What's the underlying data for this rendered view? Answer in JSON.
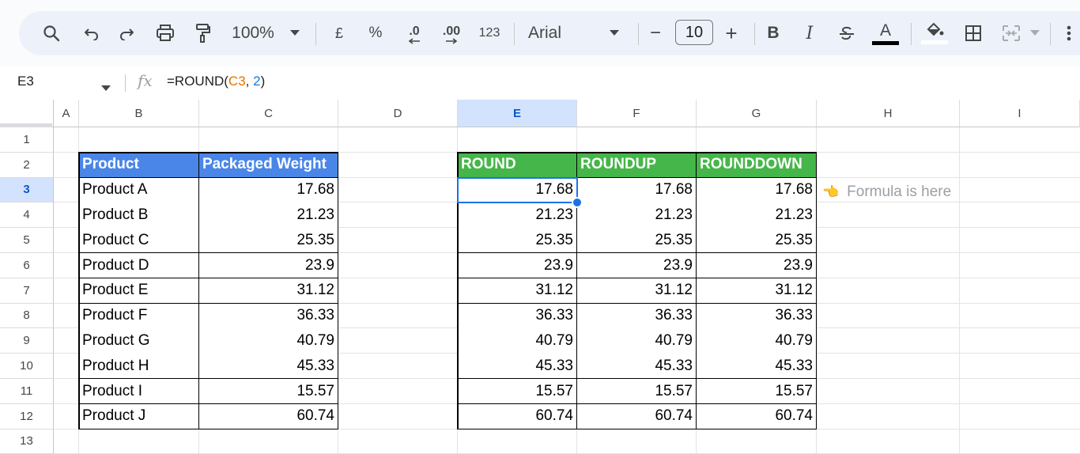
{
  "toolbar": {
    "zoom": "100%",
    "currency": "£",
    "percent": "%",
    "dec_decrease": ".0",
    "dec_increase": ".00",
    "number_format": "123",
    "font_name": "Arial",
    "font_size": "10",
    "minus": "−",
    "plus": "+",
    "bold": "B",
    "italic": "I",
    "text_color_letter": "A"
  },
  "formula_bar": {
    "name_box": "E3",
    "fx": "fx",
    "formula_prefix": "=ROUND(",
    "formula_ref": "C3",
    "formula_comma": ", ",
    "formula_num": "2",
    "formula_suffix": ")"
  },
  "columns": [
    "A",
    "B",
    "C",
    "D",
    "E",
    "F",
    "G",
    "H",
    "I"
  ],
  "rows": [
    "1",
    "2",
    "3",
    "4",
    "5",
    "6",
    "7",
    "8",
    "9",
    "10",
    "11",
    "12",
    "13"
  ],
  "selected_column": "E",
  "selected_row": "3",
  "table1": {
    "headers": [
      "Product",
      "Packaged Weight"
    ],
    "rows": [
      [
        "Product A",
        "17.68"
      ],
      [
        "Product B",
        "21.23"
      ],
      [
        "Product C",
        "25.35"
      ],
      [
        "Product D",
        "23.9"
      ],
      [
        "Product E",
        "31.12"
      ],
      [
        "Product F",
        "36.33"
      ],
      [
        "Product G",
        "40.79"
      ],
      [
        "Product H",
        "45.33"
      ],
      [
        "Product I",
        "15.57"
      ],
      [
        "Product J",
        "60.74"
      ]
    ]
  },
  "table2": {
    "headers": [
      "ROUND",
      "ROUNDUP",
      "ROUNDDOWN"
    ],
    "rows": [
      [
        "17.68",
        "17.68",
        "17.68"
      ],
      [
        "21.23",
        "21.23",
        "21.23"
      ],
      [
        "25.35",
        "25.35",
        "25.35"
      ],
      [
        "23.9",
        "23.9",
        "23.9"
      ],
      [
        "31.12",
        "31.12",
        "31.12"
      ],
      [
        "36.33",
        "36.33",
        "36.33"
      ],
      [
        "40.79",
        "40.79",
        "40.79"
      ],
      [
        "45.33",
        "45.33",
        "45.33"
      ],
      [
        "15.57",
        "15.57",
        "15.57"
      ],
      [
        "60.74",
        "60.74",
        "60.74"
      ]
    ]
  },
  "note": {
    "icon": "pointing-hand-icon",
    "text": "Formula is here"
  },
  "colors": {
    "header_blue": "#4a86e8",
    "header_green": "#45b649",
    "selection": "#1a73e8"
  }
}
